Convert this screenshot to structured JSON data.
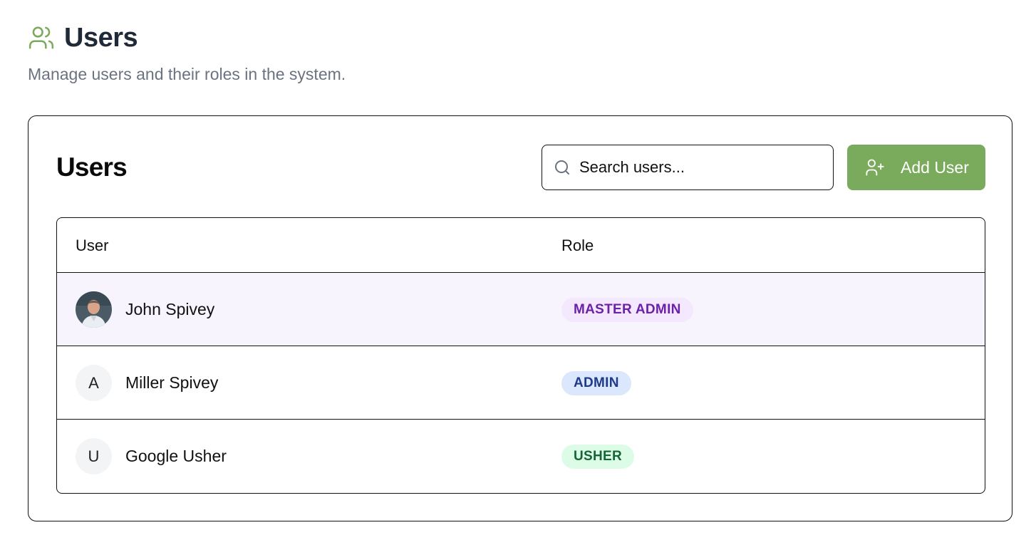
{
  "header": {
    "title": "Users",
    "subtitle": "Manage users and their roles in the system.",
    "icon": "users-icon",
    "icon_color": "#7aab5c"
  },
  "card": {
    "title": "Users",
    "search": {
      "value": "Search users...",
      "icon": "search-icon"
    },
    "add_button": {
      "label": "Add User",
      "icon": "user-plus-icon",
      "color": "#7aab5c"
    }
  },
  "table": {
    "columns": [
      "User",
      "Role"
    ],
    "rows": [
      {
        "name": "John Spivey",
        "avatar": "photo",
        "role": "MASTER ADMIN",
        "selected": true
      },
      {
        "name": "Miller Spivey",
        "avatar": "A",
        "role": "ADMIN",
        "selected": false
      },
      {
        "name": "Google Usher",
        "avatar": "U",
        "role": "USHER",
        "selected": false
      }
    ]
  },
  "colors": {
    "selected_row": "#f7f4fe",
    "master_admin_badge": "#6b21a8",
    "admin_badge": "#1e3a8a",
    "usher_badge": "#166534"
  }
}
